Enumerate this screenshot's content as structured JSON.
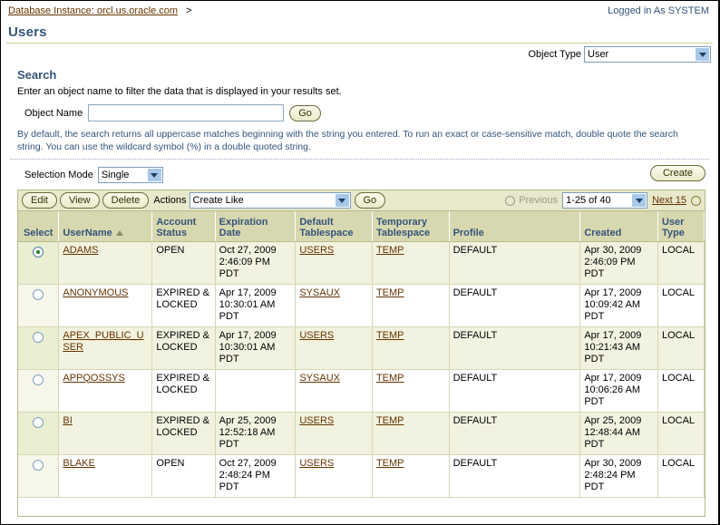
{
  "header": {
    "breadcrumb_link": "Database Instance: orcl.us.oracle.com",
    "breadcrumb_separator": ">",
    "logged_in": "Logged in As SYSTEM",
    "page_title": "Users"
  },
  "object_type": {
    "label": "Object Type",
    "value": "User"
  },
  "search": {
    "heading": "Search",
    "description": "Enter an object name to filter the data that is displayed in your results set.",
    "object_name_label": "Object Name",
    "object_name_value": "",
    "object_name_placeholder": "",
    "go_label": "Go",
    "hint": "By default, the search returns all uppercase matches beginning with the string you entered. To run an exact or case-sensitive match, double quote the search string. You can use the wildcard symbol (%) in a double quoted string."
  },
  "selection_mode": {
    "label": "Selection Mode",
    "value": "Single"
  },
  "create_button_label": "Create",
  "actions_bar": {
    "edit_label": "Edit",
    "view_label": "View",
    "delete_label": "Delete",
    "actions_label": "Actions",
    "actions_value": "Create Like",
    "go_label": "Go",
    "previous_label": "Previous",
    "range_value": "1-25 of 40",
    "next_label": "Next 15"
  },
  "table": {
    "columns": [
      "Select",
      "UserName",
      "Account Status",
      "Expiration Date",
      "Default Tablespace",
      "Temporary Tablespace",
      "Profile",
      "Created",
      "User Type"
    ],
    "sort_column": "UserName",
    "sort_direction": "ascending",
    "rows": [
      {
        "selected": true,
        "username": "ADAMS",
        "account_status": "OPEN",
        "expiration_date": "Oct 27, 2009 2:46:09 PM PDT",
        "default_tablespace": "USERS",
        "temporary_tablespace": "TEMP",
        "profile": "DEFAULT",
        "created": "Apr 30, 2009 2:46:09 PM PDT",
        "user_type": "LOCAL"
      },
      {
        "selected": false,
        "username": "ANONYMOUS",
        "account_status": "EXPIRED & LOCKED",
        "expiration_date": "Apr 17, 2009 10:30:01 AM PDT",
        "default_tablespace": "SYSAUX",
        "temporary_tablespace": "TEMP",
        "profile": "DEFAULT",
        "created": "Apr 17, 2009 10:09:42 AM PDT",
        "user_type": "LOCAL"
      },
      {
        "selected": false,
        "username": "APEX_PUBLIC_USER",
        "account_status": "EXPIRED & LOCKED",
        "expiration_date": "Apr 17, 2009 10:30:01 AM PDT",
        "default_tablespace": "USERS",
        "temporary_tablespace": "TEMP",
        "profile": "DEFAULT",
        "created": "Apr 17, 2009 10:21:43 AM PDT",
        "user_type": "LOCAL"
      },
      {
        "selected": false,
        "username": "APPQOSSYS",
        "account_status": "EXPIRED & LOCKED",
        "expiration_date": "",
        "default_tablespace": "SYSAUX",
        "temporary_tablespace": "TEMP",
        "profile": "DEFAULT",
        "created": "Apr 17, 2009 10:06:26 AM PDT",
        "user_type": "LOCAL"
      },
      {
        "selected": false,
        "username": "BI",
        "account_status": "EXPIRED & LOCKED",
        "expiration_date": "Apr 25, 2009 12:52:18 AM PDT",
        "default_tablespace": "USERS",
        "temporary_tablespace": "TEMP",
        "profile": "DEFAULT",
        "created": "Apr 25, 2009 12:48:44 AM PDT",
        "user_type": "LOCAL"
      },
      {
        "selected": false,
        "username": "BLAKE",
        "account_status": "OPEN",
        "expiration_date": "Oct 27, 2009 2:48:24 PM PDT",
        "default_tablespace": "USERS",
        "temporary_tablespace": "TEMP",
        "profile": "DEFAULT",
        "created": "Apr 30, 2009 2:48:24 PM PDT",
        "user_type": "LOCAL"
      }
    ]
  },
  "colors": {
    "title_blue": "#33557a",
    "link_brown": "#663300",
    "header_olive": "#d8d8b0",
    "bar_olive": "#e8e8cc",
    "row_alt": "#f2f2e0"
  }
}
